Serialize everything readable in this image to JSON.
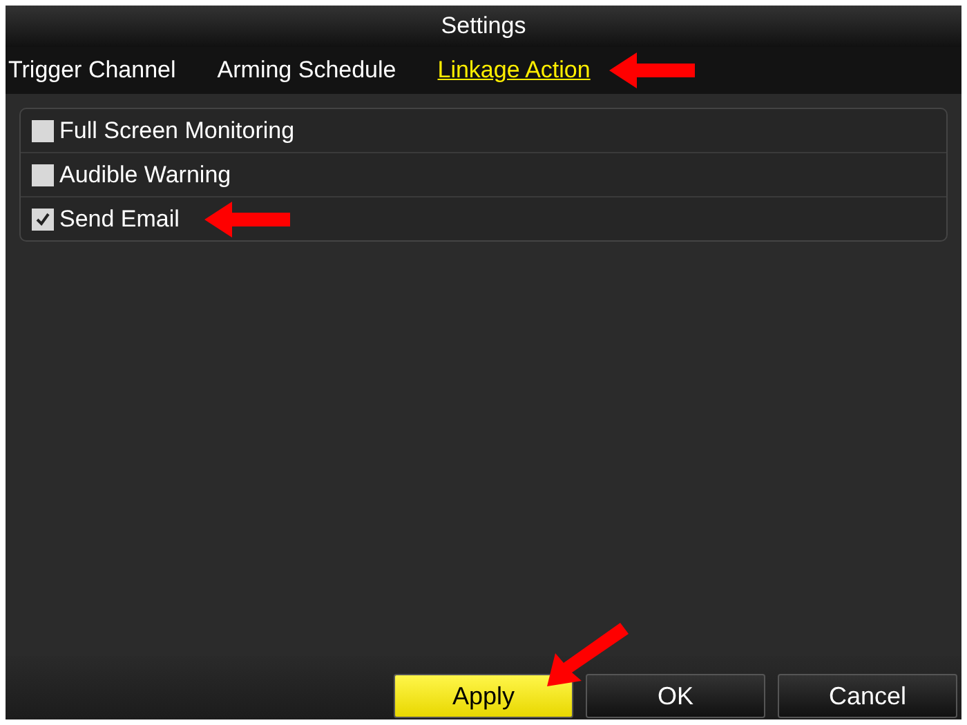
{
  "window": {
    "title": "Settings"
  },
  "tabs": [
    {
      "label": "Trigger Channel",
      "selected": false
    },
    {
      "label": "Arming Schedule",
      "selected": false
    },
    {
      "label": "Linkage Action",
      "selected": true
    }
  ],
  "actions": [
    {
      "label": "Full Screen Monitoring",
      "checked": false
    },
    {
      "label": "Audible Warning",
      "checked": false
    },
    {
      "label": "Send Email",
      "checked": true
    }
  ],
  "buttons": [
    {
      "label": "Apply",
      "selected": true
    },
    {
      "label": "OK",
      "selected": false
    },
    {
      "label": "Cancel",
      "selected": false
    }
  ]
}
